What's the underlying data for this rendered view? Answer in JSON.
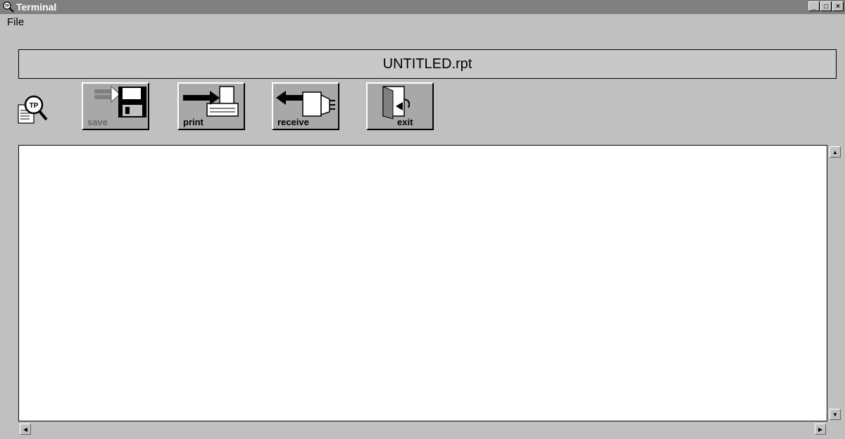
{
  "window": {
    "title": "Terminal",
    "controls": {
      "minimize": "_",
      "maximize": "□",
      "close": "×"
    }
  },
  "menu": {
    "file_label": "File"
  },
  "document": {
    "filename": "UNTITLED.rpt"
  },
  "toolbar": {
    "logo_text": "TP",
    "save_label": "save",
    "print_label": "print",
    "receive_label": "receive",
    "exit_label": "exit"
  },
  "scroll": {
    "up": "▲",
    "down": "▼",
    "left": "◀",
    "right": "▶"
  }
}
